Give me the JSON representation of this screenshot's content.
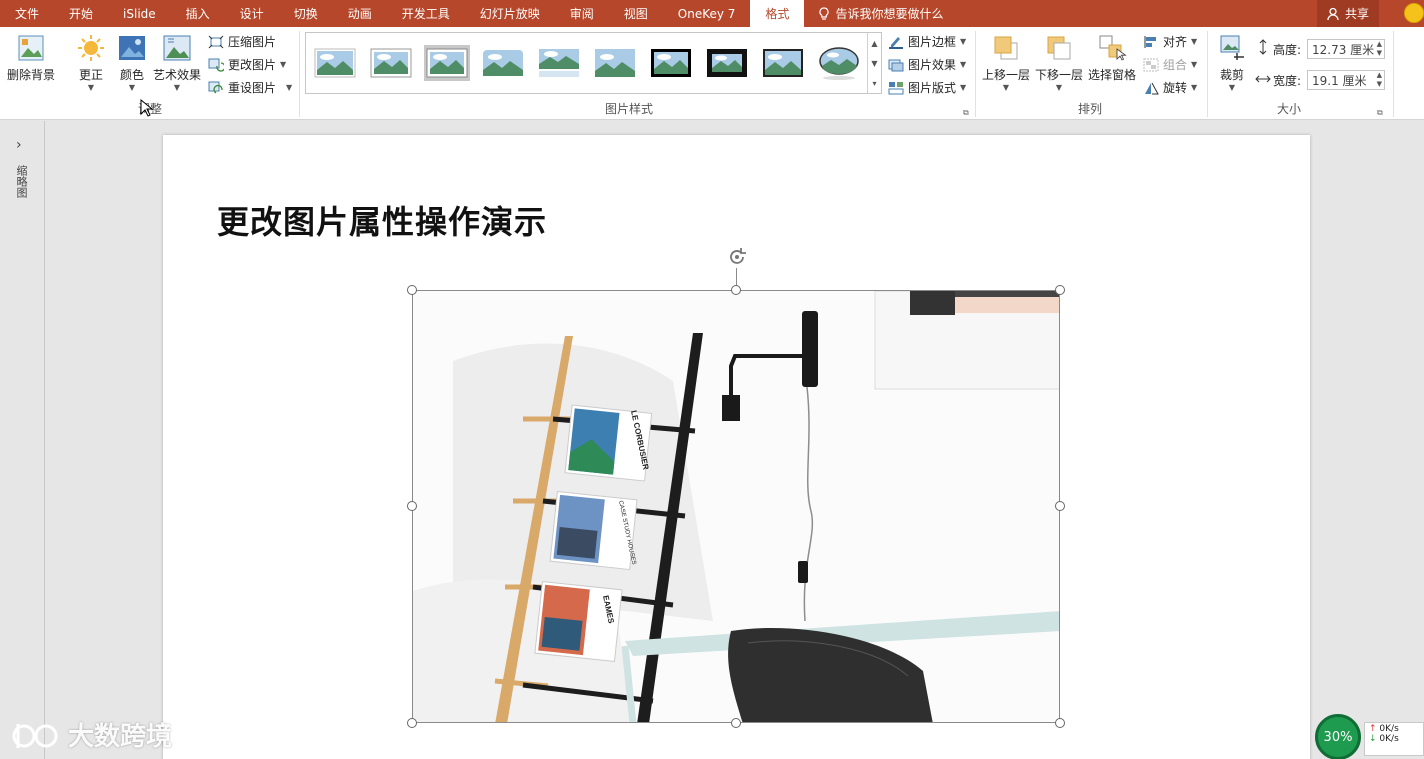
{
  "tabs": [
    "文件",
    "开始",
    "iSlide",
    "插入",
    "设计",
    "切换",
    "动画",
    "开发工具",
    "幻灯片放映",
    "审阅",
    "视图",
    "OneKey 7",
    "格式"
  ],
  "active_tab": "格式",
  "tell_me": "告诉我你想要做什么",
  "share": "共享",
  "adjust": {
    "remove_bg": "删除背景",
    "corrections": "更正",
    "color": "颜色",
    "artistic": "艺术效果",
    "compress": "压缩图片",
    "change": "更改图片",
    "reset": "重设图片",
    "group_label": "调整"
  },
  "picture_styles": {
    "group_label": "图片样式",
    "border": "图片边框",
    "effects": "图片效果",
    "layout": "图片版式"
  },
  "arrange": {
    "group_label": "排列",
    "bring_forward": "上移一层",
    "send_backward": "下移一层",
    "selection_pane": "选择窗格",
    "align": "对齐",
    "group": "组合",
    "rotate": "旋转"
  },
  "size": {
    "group_label": "大小",
    "crop": "裁剪",
    "height_label": "高度:",
    "height_value": "12.73 厘米",
    "width_label": "宽度:",
    "width_value": "19.1 厘米"
  },
  "thumbnail_pane_label": "缩略图",
  "slide_title": "更改图片属性操作演示",
  "magazine_labels": [
    "LE CORBUSIER",
    "CASE STUDY HOUSES",
    "EAMES"
  ],
  "watermark": "大数跨境",
  "net": {
    "percent": "30%",
    "up": "0K/s",
    "down": "0K/s"
  },
  "colors": {
    "accent": "#b7472a"
  }
}
